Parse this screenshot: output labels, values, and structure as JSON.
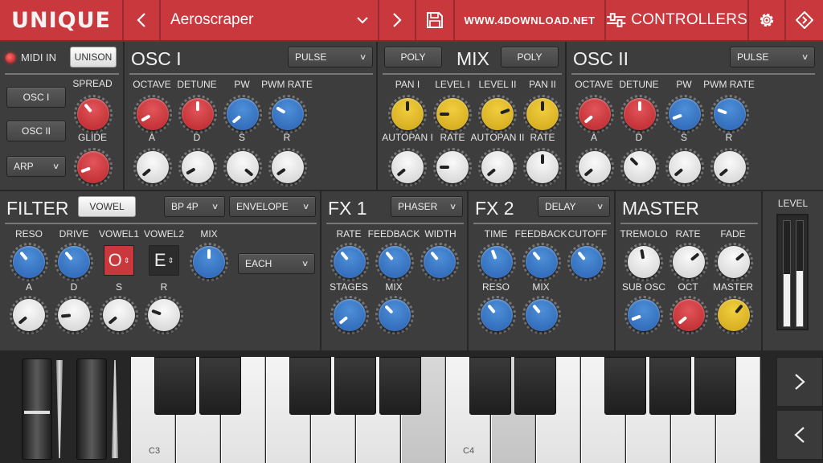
{
  "topbar": {
    "logo": "UNIQUE",
    "preset_name": "Aeroscraper",
    "url_text": "WWW.4DOWNLOAD.NET",
    "controllers_label": "CONTROLLERS"
  },
  "colors": {
    "accent": "#c8383c",
    "panel": "#3d3d3d",
    "knob_red": "#c9353a",
    "knob_blue": "#3a78c8",
    "knob_yellow": "#e0b82a",
    "knob_white": "#e6e6e6"
  },
  "left": {
    "midi_in_label": "MIDI IN",
    "unison_label": "UNISON",
    "osc1_button": "OSC I",
    "osc2_button": "OSC II",
    "arp_select": "ARP",
    "spread_label": "SPREAD",
    "glide_label": "GLIDE"
  },
  "osc1": {
    "title": "OSC I",
    "wave": "PULSE",
    "labels": [
      "OCTAVE",
      "DETUNE",
      "PW",
      "PWM RATE",
      "A",
      "D",
      "S",
      "R"
    ]
  },
  "mix": {
    "title": "MIX",
    "poly1": "POLY",
    "poly2": "POLY",
    "labels": [
      "PAN I",
      "LEVEL I",
      "LEVEL II",
      "PAN II",
      "AUTOPAN I",
      "RATE",
      "AUTOPAN II",
      "RATE"
    ]
  },
  "osc2": {
    "title": "OSC II",
    "wave": "PULSE",
    "labels": [
      "OCTAVE",
      "DETUNE",
      "PW",
      "PWM RATE",
      "A",
      "D",
      "S",
      "R"
    ]
  },
  "filter": {
    "title": "FILTER",
    "vowel_button": "VOWEL",
    "mode": "BP 4P",
    "source": "ENVELOPE",
    "labels": [
      "RESO",
      "DRIVE",
      "VOWEL1",
      "VOWEL2",
      "MIX",
      "A",
      "D",
      "S",
      "R"
    ],
    "vowel1_value": "O",
    "vowel2_value": "E",
    "each_select": "EACH"
  },
  "fx1": {
    "title": "FX 1",
    "effect": "PHASER",
    "labels": [
      "RATE",
      "FEEDBACK",
      "WIDTH",
      "STAGES",
      "MIX"
    ]
  },
  "fx2": {
    "title": "FX 2",
    "effect": "DELAY",
    "labels": [
      "TIME",
      "FEEDBACK",
      "CUTOFF",
      "RESO",
      "MIX"
    ]
  },
  "master": {
    "title": "MASTER",
    "labels": [
      "TREMOLO",
      "RATE",
      "FADE",
      "SUB OSC",
      "OCT",
      "MASTER"
    ]
  },
  "level": {
    "label": "LEVEL",
    "left_fraction": 0.5,
    "right_fraction": 0.53
  },
  "keyboard": {
    "c3_label": "C3",
    "c4_label": "C4"
  }
}
